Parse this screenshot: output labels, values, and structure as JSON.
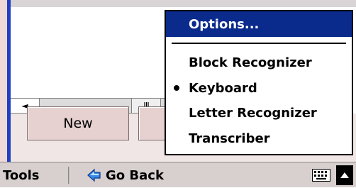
{
  "popup_menu": {
    "title": "Options...",
    "items": [
      {
        "label": "Block Recognizer",
        "selected": false
      },
      {
        "label": "Keyboard",
        "selected": true
      },
      {
        "label": "Letter Recognizer",
        "selected": false
      },
      {
        "label": "Transcriber",
        "selected": false
      }
    ]
  },
  "buttons": {
    "new_label": "New"
  },
  "scrollbar": {
    "left_arrow": "◄",
    "thumb_grip": "III"
  },
  "menubar": {
    "tools_label": "Tools",
    "go_back_label": "Go Back",
    "icons": [
      "back-arrow-icon",
      "keyboard-icon",
      "up-arrow-icon"
    ]
  },
  "colors": {
    "title_bar": "#0a2a8c",
    "accent_blue": "#1f3fbf",
    "button_face": "#e6d0d0",
    "menubar_bg": "#d8cfcf"
  }
}
